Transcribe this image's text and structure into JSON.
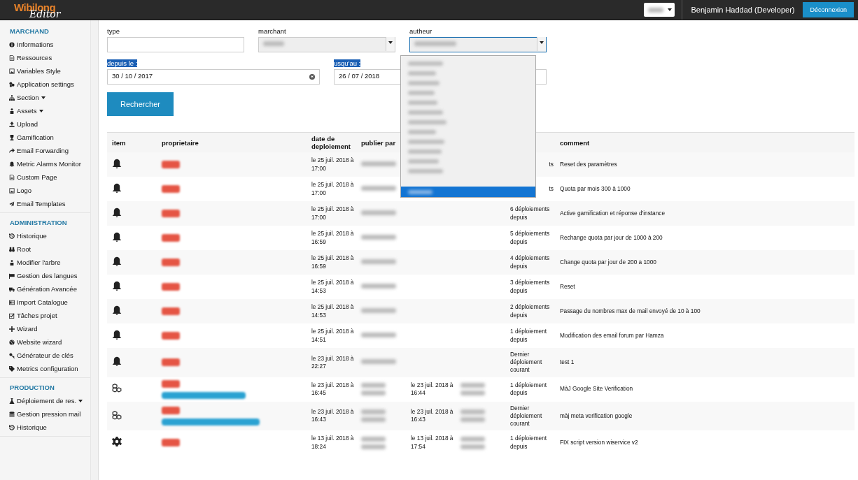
{
  "topbar": {
    "logo_main": "Wibilong",
    "logo_sub": "Editor",
    "user": "Benjamin Haddad (Developer)",
    "logout_button": "Déconnexion"
  },
  "sidebar": [
    {
      "title": "MARCHAND",
      "items": [
        {
          "label": "Informations",
          "has_menu": false
        },
        {
          "label": "Ressources",
          "has_menu": false
        },
        {
          "label": "Variables Style",
          "has_menu": false
        },
        {
          "label": "Application settings",
          "has_menu": false
        },
        {
          "label": "Section",
          "has_menu": true
        },
        {
          "label": "Assets",
          "has_menu": true
        },
        {
          "label": "Upload",
          "has_menu": false
        },
        {
          "label": "Gamification",
          "has_menu": false
        },
        {
          "label": "Email Forwarding",
          "has_menu": false
        },
        {
          "label": "Metric Alarms Monitor",
          "has_menu": false
        },
        {
          "label": "Custom Page",
          "has_menu": false
        },
        {
          "label": "Logo",
          "has_menu": false
        },
        {
          "label": "Email Templates",
          "has_menu": false
        }
      ]
    },
    {
      "title": "ADMINISTRATION",
      "items": [
        {
          "label": "Historique",
          "has_menu": false
        },
        {
          "label": "Root",
          "has_menu": false
        },
        {
          "label": "Modifier l'arbre",
          "has_menu": false
        },
        {
          "label": "Gestion des langues",
          "has_menu": false
        },
        {
          "label": "Génération Avancée",
          "has_menu": false
        },
        {
          "label": "Import Catalogue",
          "has_menu": false
        },
        {
          "label": "Tâches projet",
          "has_menu": false
        },
        {
          "label": "Wizard",
          "has_menu": false
        },
        {
          "label": "Website wizard",
          "has_menu": false
        },
        {
          "label": "Générateur de clés",
          "has_menu": false
        },
        {
          "label": "Metrics configuration",
          "has_menu": false
        }
      ]
    },
    {
      "title": "PRODUCTION",
      "items": [
        {
          "label": "Déploiement de res.",
          "has_menu": true
        },
        {
          "label": "Gestion pression mail",
          "has_menu": false
        },
        {
          "label": "Historique",
          "has_menu": false
        }
      ]
    }
  ],
  "filters": {
    "type_label": "type",
    "merchant_label": "marchant",
    "author_label": "autheur",
    "author_dropdown_open": true,
    "from_label": "depuis le :",
    "from_label_selected": true,
    "from_value": "30 / 10 / 2017",
    "to_label": "usqu'au :",
    "to_label_selected": true,
    "to_value": "26 / 07 / 2018",
    "search_button": "Rechercher"
  },
  "table": {
    "columns": [
      "item",
      "proprietaire",
      "date de\ndeploiement",
      "publier par",
      null,
      null,
      null,
      "comment"
    ],
    "rows": [
      {
        "kind": "bell",
        "has_link": false,
        "date": "le 25 juil. 2018 à\n17:00",
        "status": "ts",
        "comment": "Reset des paramètres"
      },
      {
        "kind": "bell",
        "has_link": false,
        "date": "le 25 juil. 2018 à\n17:00",
        "status": "ts",
        "comment": "Quota par mois 300 à 1000"
      },
      {
        "kind": "bell",
        "has_link": false,
        "date": "le 25 juil. 2018 à\n17:00",
        "status": "6 déploiements\ndepuis",
        "comment": "Active gamification et réponse d'instance"
      },
      {
        "kind": "bell",
        "has_link": false,
        "date": "le 25 juil. 2018 à\n16:59",
        "status": "5 déploiements\ndepuis",
        "comment": "Rechange quota par jour de 1000 à 200"
      },
      {
        "kind": "bell",
        "has_link": false,
        "date": "le 25 juil. 2018 à\n16:59",
        "status": "4 déploiements\ndepuis",
        "comment": "Change quota par jour de 200 a 1000"
      },
      {
        "kind": "bell",
        "has_link": false,
        "date": "le 25 juil. 2018 à\n14:53",
        "status": "3 déploiements\ndepuis",
        "comment": "Reset"
      },
      {
        "kind": "bell",
        "has_link": false,
        "date": "le 25 juil. 2018 à\n14:53",
        "status": "2 déploiements\ndepuis",
        "comment": "Passage du nombres max de mail envoyé de 10 à 100"
      },
      {
        "kind": "bell",
        "has_link": false,
        "date": "le 25 juil. 2018 à\n14:51",
        "status": "1 déploiement\ndepuis",
        "comment": "Modification des email forum par Hamza"
      },
      {
        "kind": "bell",
        "has_link": false,
        "date": "le 23 juil. 2018 à\n22:27",
        "status": "Dernier\ndéploiement\ncourant",
        "comment": "test 1"
      },
      {
        "kind": "cubes",
        "has_link": true,
        "date": "le 23 juil. 2018 à\n16:45",
        "validated": "le 23 juil. 2018 à\n16:44",
        "status": "1 déploiement\ndepuis",
        "comment": "MàJ Google Site Verification"
      },
      {
        "kind": "cubes",
        "has_link": true,
        "date": "le 23 juil. 2018 à\n16:43",
        "validated": "le 23 juil. 2018 à\n16:43",
        "status": "Dernier\ndéploiement\ncourant",
        "comment": "màj meta verification google"
      },
      {
        "kind": "gear",
        "has_link": false,
        "date": "le 13 juil. 2018 à\n18:24",
        "validated": "le 13 juil. 2018 à\n17:54",
        "status": "1 déploiement\ndepuis",
        "comment": "FIX script version wiservice v2"
      }
    ]
  }
}
